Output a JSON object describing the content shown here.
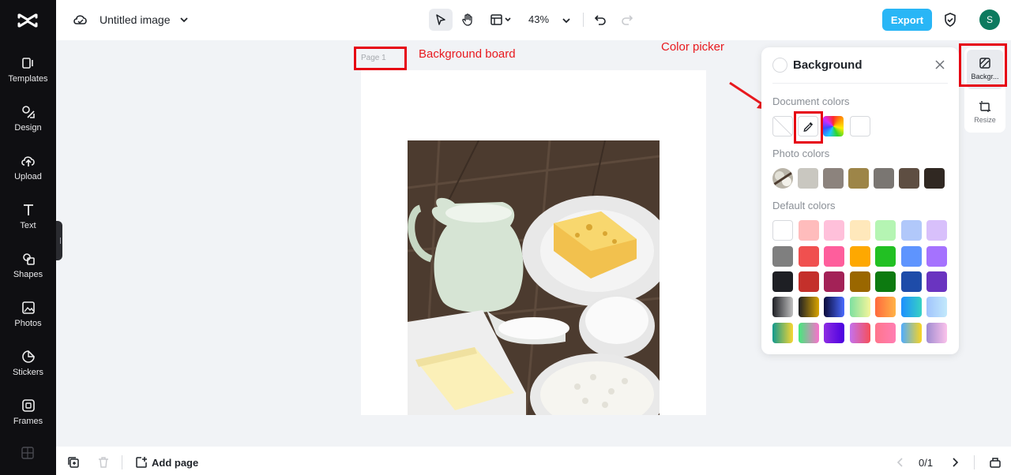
{
  "app": {
    "title": "Untitled image"
  },
  "sidebar": {
    "items": [
      {
        "label": "Templates",
        "icon": "templates-icon"
      },
      {
        "label": "Design",
        "icon": "design-icon"
      },
      {
        "label": "Upload",
        "icon": "upload-icon"
      },
      {
        "label": "Text",
        "icon": "text-icon"
      },
      {
        "label": "Shapes",
        "icon": "shapes-icon"
      },
      {
        "label": "Photos",
        "icon": "photos-icon"
      },
      {
        "label": "Stickers",
        "icon": "stickers-icon"
      },
      {
        "label": "Frames",
        "icon": "frames-icon"
      }
    ]
  },
  "toolbar": {
    "zoom": "43%",
    "export_label": "Export",
    "avatar_initial": "S"
  },
  "canvas": {
    "page_label": "Page 1"
  },
  "annotations": {
    "background_board": "Background board",
    "color_picker": "Color picker"
  },
  "panel": {
    "title": "Background",
    "document_colors_label": "Document colors",
    "photo_colors_label": "Photo colors",
    "default_colors_label": "Default colors",
    "photo_colors": [
      "#c9c7c0",
      "#8c837d",
      "#9d8548",
      "#7a7672",
      "#5e4e42",
      "#302822"
    ],
    "default_colors": [
      [
        "#ffffff",
        "#ffbcbc",
        "#ffc0da",
        "#ffe8bb",
        "#b5f5b3",
        "#b1c8fa",
        "#d8c0fb"
      ],
      [
        "#7f7f7f",
        "#f0504f",
        "#fe5e9c",
        "#fea801",
        "#22c023",
        "#5e94fe",
        "#a572fe"
      ],
      [
        "#1e1f24",
        "#c4302b",
        "#a32257",
        "#9a6700",
        "#0d7a10",
        "#1e4ca9",
        "#6a34c0"
      ]
    ],
    "accent_color": "#29b6f6"
  },
  "right_rail": {
    "background_label": "Backgr...",
    "resize_label": "Resize"
  },
  "bottom": {
    "add_page_label": "Add page",
    "page_count": "0/1"
  }
}
